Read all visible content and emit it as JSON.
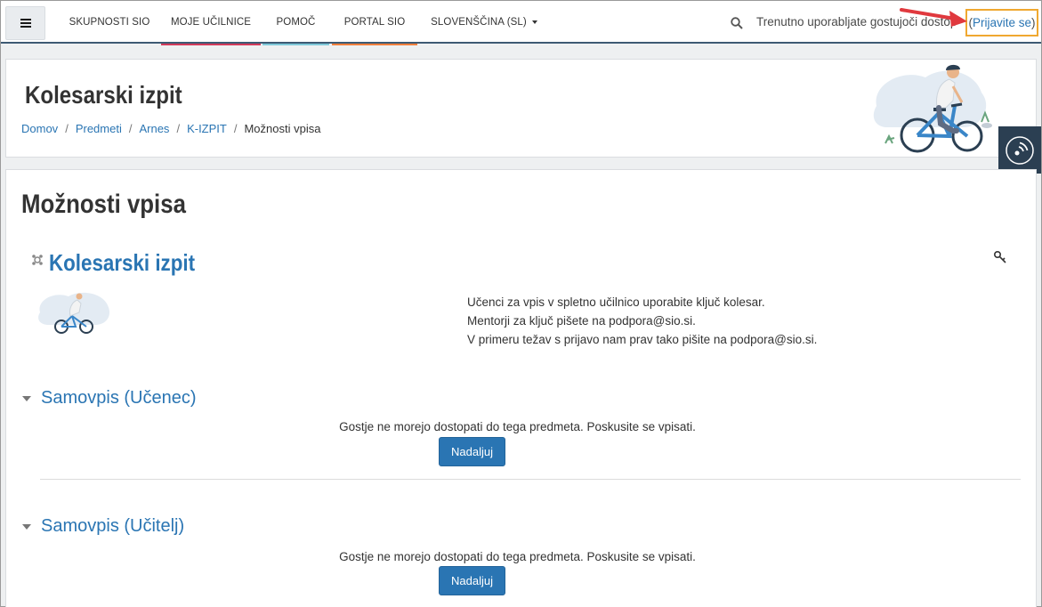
{
  "navbar": {
    "menu_icon": "hamburger-icon",
    "items": [
      {
        "label": "SKUPNOSTI SIO",
        "accent": "#ffffff"
      },
      {
        "label": "MOJE UČILNICE",
        "accent": "#d13a5a"
      },
      {
        "label": "POMOČ",
        "accent": "#7ec8d8"
      },
      {
        "label": "PORTAL SIO",
        "accent": "#f07f3c"
      },
      {
        "label": "SLOVENŠČINA (SL)",
        "accent": "#ffffff"
      }
    ],
    "search_icon": "search-icon",
    "guest_text": "Trenutno uporabljate gostujoči dostop",
    "login_open": "(",
    "login_link": "Prijavite se",
    "login_close": ")"
  },
  "header": {
    "course_title": "Kolesarski izpit",
    "breadcrumb": [
      "Domov",
      "Predmeti",
      "Arnes",
      "K-IZPIT",
      "Možnosti vpisa"
    ],
    "separator": "/"
  },
  "main": {
    "heading": "Možnosti vpisa",
    "course_name": "Kolesarski izpit",
    "summary": [
      "Učenci za vpis v spletno učilnico uporabite ključ kolesar.",
      "Mentorji za ključ pišete na podpora@sio.si.",
      "V primeru težav s prijavo nam prav tako pišite na podpora@sio.si."
    ],
    "sections": [
      {
        "title": "Samovpis (Učenec)",
        "notice": "Gostje ne morejo dostopati do tega predmeta. Poskusite se vpisati.",
        "button": "Nadaljuj"
      },
      {
        "title": "Samovpis (Učitelj)",
        "notice": "Gostje ne morejo dostopati do tega predmeta. Poskusite se vpisati.",
        "button": "Nadaljuj"
      }
    ]
  },
  "colors": {
    "link": "#2a75b3",
    "highlight": "#f0a830",
    "arrow": "#e0393e",
    "float_button": "#2b3f52"
  }
}
